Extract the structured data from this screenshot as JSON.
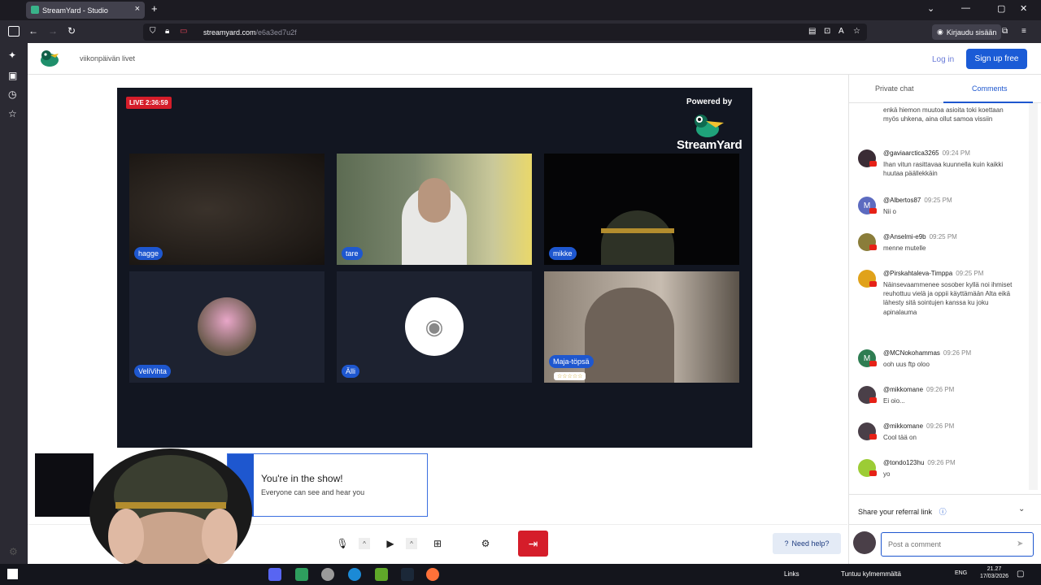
{
  "browser": {
    "tab_title": "StreamYard - Studio",
    "url_host": "streamyard.com",
    "url_path": "/e6a3ed7u2f",
    "account_label": "Kirjaudu sisään"
  },
  "header": {
    "studio_name": "viikonpäivän livet",
    "login_label": "Log in",
    "signup_label": "Sign up free"
  },
  "stage": {
    "live_badge": "LIVE 2:36:59",
    "powered_by": "Powered by",
    "brand": "StreamYard",
    "participants": [
      {
        "name": "hagge"
      },
      {
        "name": "tare"
      },
      {
        "name": "mikke"
      },
      {
        "name": "VeliVihta"
      },
      {
        "name": "Älli"
      },
      {
        "name": "Maja-töpsä",
        "stars": "☆☆☆☆☆"
      }
    ]
  },
  "toast": {
    "title": "You're in the show!",
    "subtitle": "Everyone can see and hear you"
  },
  "controls": {
    "need_help": "Need help?"
  },
  "chat": {
    "tab_private": "Private chat",
    "tab_comments": "Comments",
    "top_text": "enkä hiemon muutoa asioita toki koettaan myös uhkena, aina ollut samoa vissiin",
    "comments": [
      {
        "user": "@gaviaarctica3265",
        "time": "09:24 PM",
        "text": "Ihan vitun rasittavaa kuunnella kuin kaikki huutaa päällekkäin",
        "avatar_color": "#3a2c35",
        "initial": ""
      },
      {
        "user": "@Albertos87",
        "time": "09:25 PM",
        "text": "Nii o",
        "avatar_color": "#5c6bc0",
        "initial": "M"
      },
      {
        "user": "@Anselmi-e9b",
        "time": "09:25 PM",
        "text": "menne mutelle",
        "avatar_color": "#8a7d3a",
        "initial": ""
      },
      {
        "user": "@Pirskahtaleva-Timppa",
        "time": "09:25 PM",
        "text": "Näinsevaammenee sosober kyllä noi ihmiset reuhottuu vielä ja oppii käyttämään Alta eikä lähesty sitä sointujen kanssa ku joku apinalauma",
        "avatar_color": "#e0a21a",
        "initial": ""
      },
      {
        "user": "@MCNokohammas",
        "time": "09:26 PM",
        "text": "ooh uus ftp oloo",
        "avatar_color": "#2e7d52",
        "initial": "M"
      },
      {
        "user": "@mikkomane",
        "time": "09:26 PM",
        "text": "Ei oio...",
        "avatar_color": "#4a3f48",
        "initial": ""
      },
      {
        "user": "@mikkomane",
        "time": "09:26 PM",
        "text": "Cool tää on",
        "avatar_color": "#4a3f48",
        "initial": ""
      },
      {
        "user": "@tondo123hu",
        "time": "09:26 PM",
        "text": "yo",
        "avatar_color": "#9ccc35",
        "initial": ""
      }
    ],
    "referral_label": "Share your referral link",
    "input_placeholder": "Post a comment"
  },
  "taskbar": {
    "links_label": "Links",
    "tray_text": "Tuntuu kylmemmältä",
    "lang": "ENG",
    "time": "21.27",
    "date": "17/03/2026"
  },
  "colors": {
    "accent": "#1e57cf",
    "live": "#d51d2a",
    "stage_bg": "#121621"
  }
}
